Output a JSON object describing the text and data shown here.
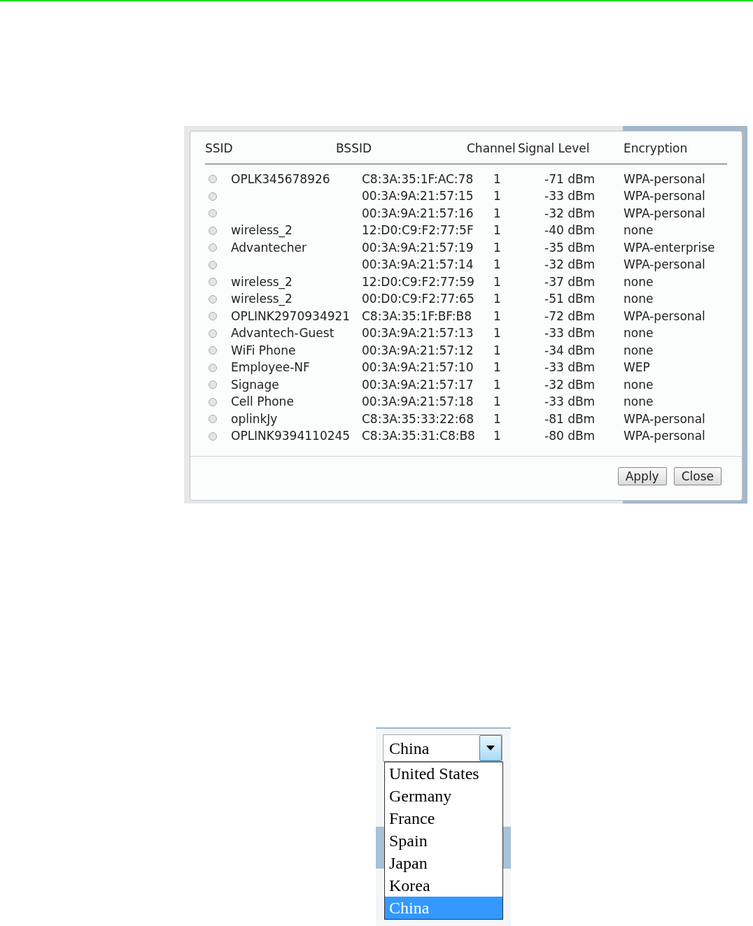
{
  "scan_dialog": {
    "columns": [
      "SSID",
      "BSSID",
      "Channel",
      "Signal Level",
      "Encryption"
    ],
    "rows": [
      {
        "ssid": "OPLK345678926",
        "bssid": "C8:3A:35:1F:AC:78",
        "channel": "1",
        "signal": "-71 dBm",
        "encryption": "WPA-personal",
        "selected": false
      },
      {
        "ssid": "",
        "bssid": "00:3A:9A:21:57:15",
        "channel": "1",
        "signal": "-33 dBm",
        "encryption": "WPA-personal",
        "selected": false
      },
      {
        "ssid": "",
        "bssid": "00:3A:9A:21:57:16",
        "channel": "1",
        "signal": "-32 dBm",
        "encryption": "WPA-personal",
        "selected": false
      },
      {
        "ssid": "wireless_2",
        "bssid": "12:D0:C9:F2:77:5F",
        "channel": "1",
        "signal": "-40 dBm",
        "encryption": "none",
        "selected": false
      },
      {
        "ssid": "Advantecher",
        "bssid": "00:3A:9A:21:57:19",
        "channel": "1",
        "signal": "-35 dBm",
        "encryption": "WPA-enterprise",
        "selected": false
      },
      {
        "ssid": "",
        "bssid": "00:3A:9A:21:57:14",
        "channel": "1",
        "signal": "-32 dBm",
        "encryption": "WPA-personal",
        "selected": false
      },
      {
        "ssid": "wireless_2",
        "bssid": "12:D0:C9:F2:77:59",
        "channel": "1",
        "signal": "-37 dBm",
        "encryption": "none",
        "selected": false
      },
      {
        "ssid": "wireless_2",
        "bssid": "00:D0:C9:F2:77:65",
        "channel": "1",
        "signal": "-51 dBm",
        "encryption": "none",
        "selected": false
      },
      {
        "ssid": "OPLINK2970934921",
        "bssid": "C8:3A:35:1F:BF:B8",
        "channel": "1",
        "signal": "-72 dBm",
        "encryption": "WPA-personal",
        "selected": false
      },
      {
        "ssid": "Advantech-Guest",
        "bssid": "00:3A:9A:21:57:13",
        "channel": "1",
        "signal": "-33 dBm",
        "encryption": "none",
        "selected": false
      },
      {
        "ssid": "WiFi Phone",
        "bssid": "00:3A:9A:21:57:12",
        "channel": "1",
        "signal": "-34 dBm",
        "encryption": "none",
        "selected": false
      },
      {
        "ssid": "Employee-NF",
        "bssid": "00:3A:9A:21:57:10",
        "channel": "1",
        "signal": "-33 dBm",
        "encryption": "WEP",
        "selected": false
      },
      {
        "ssid": "Signage",
        "bssid": "00:3A:9A:21:57:17",
        "channel": "1",
        "signal": "-32 dBm",
        "encryption": "none",
        "selected": false
      },
      {
        "ssid": "Cell Phone",
        "bssid": "00:3A:9A:21:57:18",
        "channel": "1",
        "signal": "-33 dBm",
        "encryption": "none",
        "selected": false
      },
      {
        "ssid": "oplinkJy",
        "bssid": "C8:3A:35:33:22:68",
        "channel": "1",
        "signal": "-81 dBm",
        "encryption": "WPA-personal",
        "selected": false
      },
      {
        "ssid": "OPLINK9394110245",
        "bssid": "C8:3A:35:31:C8:B8",
        "channel": "1",
        "signal": "-80 dBm",
        "encryption": "WPA-personal",
        "selected": false
      }
    ],
    "buttons": [
      "Apply",
      "Close"
    ]
  },
  "country_dropdown": {
    "value": "China",
    "options": [
      {
        "label": "United States",
        "selected": false
      },
      {
        "label": "Germany",
        "selected": false
      },
      {
        "label": "France",
        "selected": false
      },
      {
        "label": "Spain",
        "selected": false
      },
      {
        "label": "Japan",
        "selected": false
      },
      {
        "label": "Korea",
        "selected": false
      },
      {
        "label": "China",
        "selected": true
      }
    ]
  }
}
